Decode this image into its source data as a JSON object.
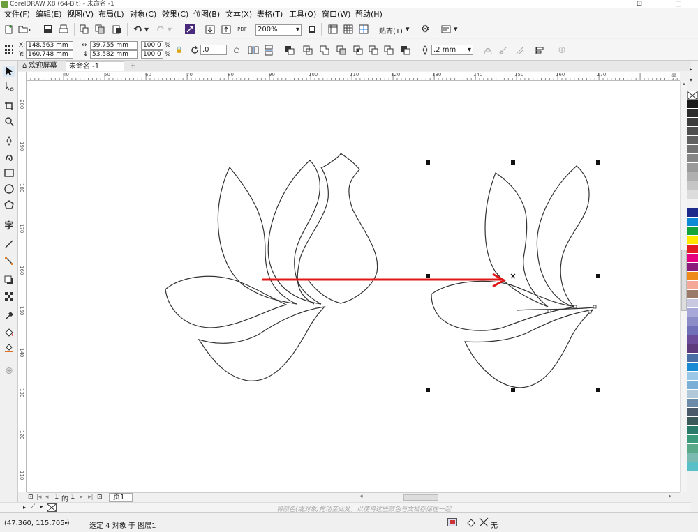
{
  "window": {
    "title": "CorelDRAW X8 (64-Bit) - 未命名 -1"
  },
  "menu": [
    {
      "label": "文件(F)"
    },
    {
      "label": "编辑(E)"
    },
    {
      "label": "视图(V)"
    },
    {
      "label": "布局(L)"
    },
    {
      "label": "对象(C)"
    },
    {
      "label": "效果(C)"
    },
    {
      "label": "位图(B)"
    },
    {
      "label": "文本(X)"
    },
    {
      "label": "表格(T)"
    },
    {
      "label": "工具(O)"
    },
    {
      "label": "窗口(W)"
    },
    {
      "label": "帮助(H)"
    }
  ],
  "toolbar": {
    "zoom_value": "200%",
    "snap_label": "贴齐(T)",
    "pdf_label": "PDF"
  },
  "properties": {
    "x_label": "X:",
    "x_value": "148.563 mm",
    "y_label": "Y:",
    "y_value": "160.748 mm",
    "w_value": "39.755 mm",
    "h_value": "53.582 mm",
    "scale_w": "100.0",
    "scale_h": "100.0",
    "percent": "%",
    "rotation": ".0",
    "outline_width": ".2 mm"
  },
  "tabs": [
    {
      "label": "欢迎屏幕"
    },
    {
      "label": "未命名 -1"
    }
  ],
  "ruler": {
    "h_labels": [
      "40",
      "50",
      "60",
      "70",
      "80",
      "90",
      "100",
      "110",
      "120",
      "130",
      "140",
      "150",
      "160",
      "170"
    ],
    "h_unit": "毫米",
    "v_labels": [
      "200",
      "190",
      "180",
      "170",
      "160",
      "150",
      "140",
      "130",
      "120",
      "110"
    ]
  },
  "page_nav": {
    "current": "1",
    "of_label": "的",
    "total": "1",
    "page_tab": "页1"
  },
  "hint": "将颜色(或对象)拖动至此处，以便将这些颜色与文档存储在一起",
  "status": {
    "coords": "(47.360, 115.705 )",
    "selection": "选定 4 对象 于 图层1",
    "fill_none": "无"
  },
  "palette": [
    "#ffffff",
    "#1a1a1a",
    "#2b2b2b",
    "#3d3d3d",
    "#4f4f4f",
    "#616161",
    "#737373",
    "#868686",
    "#9a9a9a",
    "#b0b0b0",
    "#c6c6c6",
    "#dcdcdc",
    "#f2f2f2",
    "#1c2a8c",
    "#0d8ad6",
    "#14a53a",
    "#ffe800",
    "#e31b23",
    "#e4007f",
    "#8a1c7c",
    "#ee8a1a",
    "#f4a89a",
    "#9b7a6a",
    "#c8c8e0",
    "#a8a8d8",
    "#8c8cc8",
    "#7070b8",
    "#6b4c9a",
    "#5c3a7c",
    "#4a6fa5",
    "#1a8ad4",
    "#9cc8e8",
    "#7ab0d8",
    "#b0c8d8",
    "#6a8aa8",
    "#4a5a6a",
    "#3a5a5a",
    "#2a7a6a",
    "#3a9a7a",
    "#5aaa8a",
    "#7abab0",
    "#5ac0c8"
  ],
  "colors": {
    "arrow": "#e01818",
    "outline": "#333333",
    "accent": "#2c7be5"
  },
  "icons": {
    "new": "new-document-icon",
    "open": "open-icon",
    "save": "save-icon",
    "print": "print-icon",
    "undo": "undo-icon",
    "redo": "redo-icon",
    "import": "import-icon",
    "export": "export-icon",
    "settings": "gear-icon"
  }
}
